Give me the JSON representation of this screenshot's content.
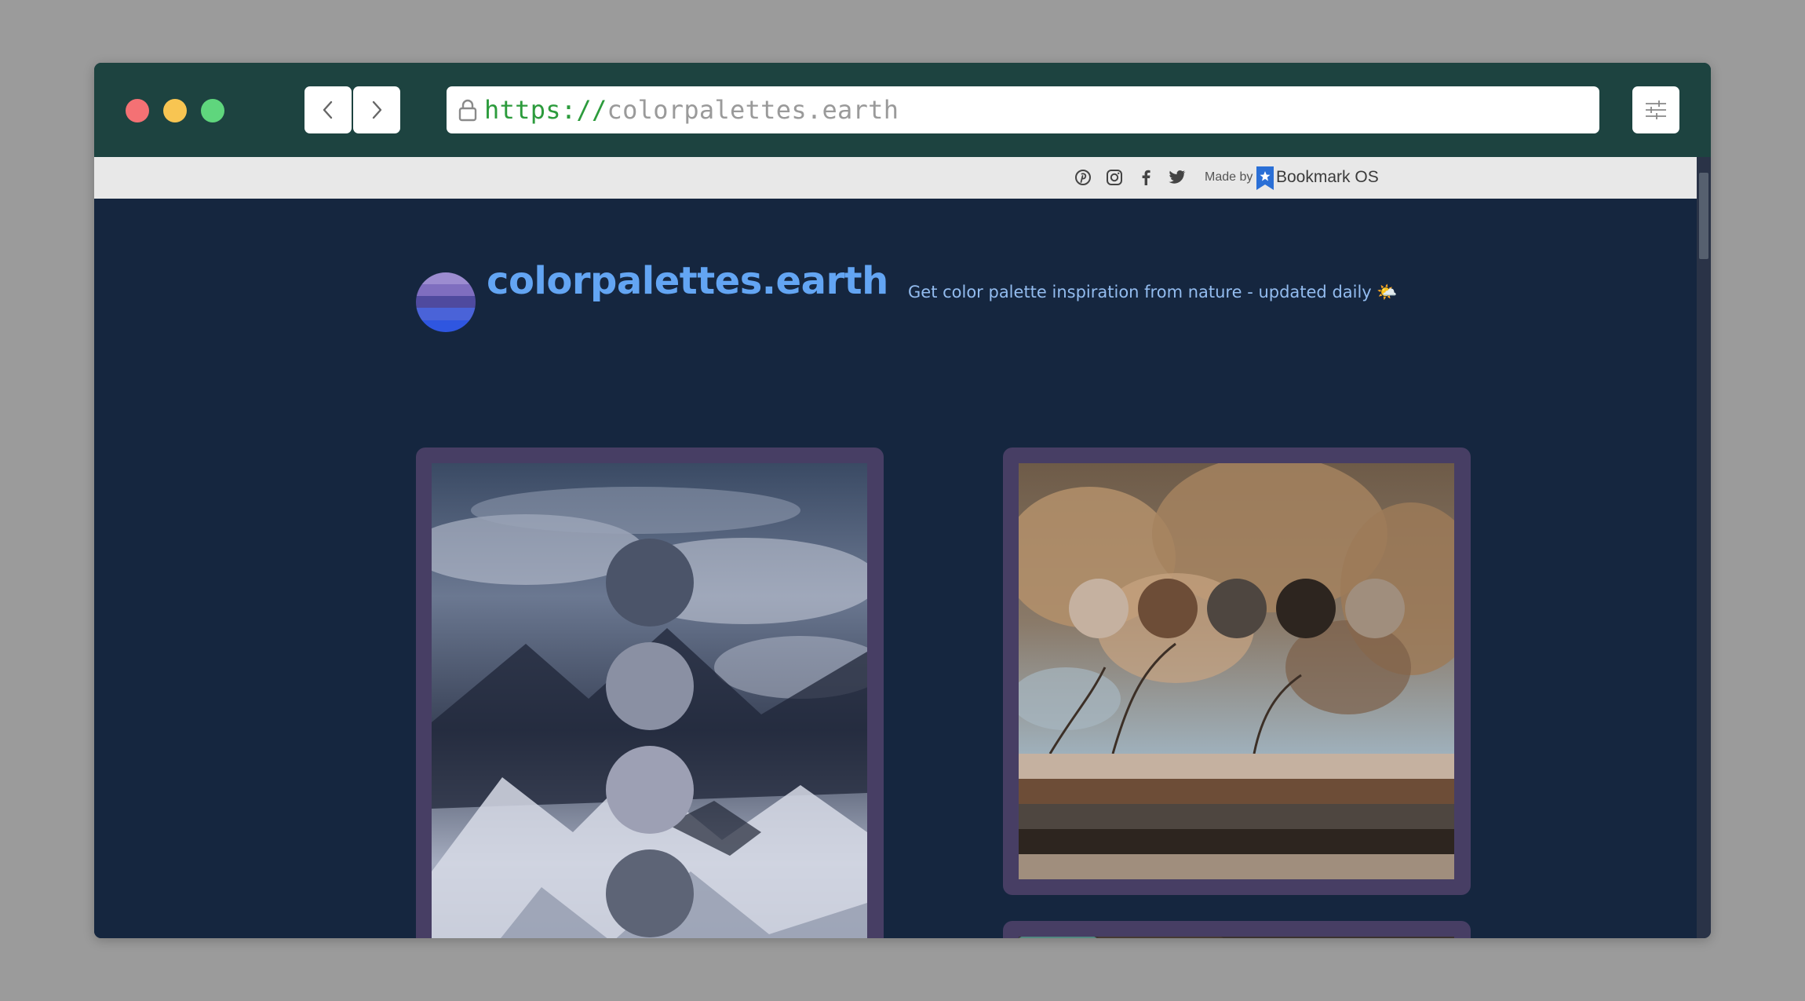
{
  "browser": {
    "url_scheme": "https://",
    "url_host": "colorpalettes.earth",
    "icons": {
      "back": "chevron-left-icon",
      "forward": "chevron-right-icon",
      "lock": "lock-icon",
      "menu": "sliders-icon"
    },
    "colors": {
      "chrome": "#1d4340",
      "close": "#f47174",
      "minimize": "#f8c552",
      "maximize": "#5fd67d"
    }
  },
  "topbar": {
    "social_icons": [
      "pinterest-icon",
      "instagram-icon",
      "facebook-icon",
      "twitter-icon"
    ],
    "made_by_label": "Made by",
    "brand_name": "Bookmark OS"
  },
  "site": {
    "title": "colorpalettes.earth",
    "tagline": "Get color palette inspiration from nature - updated daily 🌤️",
    "background": "#15263f",
    "card_color": "#473e64",
    "title_color": "#63a5f3"
  },
  "palettes": [
    {
      "subject": "snowy mountains from above",
      "colors": [
        "#4b5469",
        "#8a90a3",
        "#9da0b4",
        "#5d6476",
        "#1f2536"
      ]
    },
    {
      "subject": "dried hydrangea flowers",
      "colors": [
        "#c5b1a0",
        "#6d4d37",
        "#4e4640",
        "#2d251f",
        "#a08e7d"
      ]
    }
  ]
}
